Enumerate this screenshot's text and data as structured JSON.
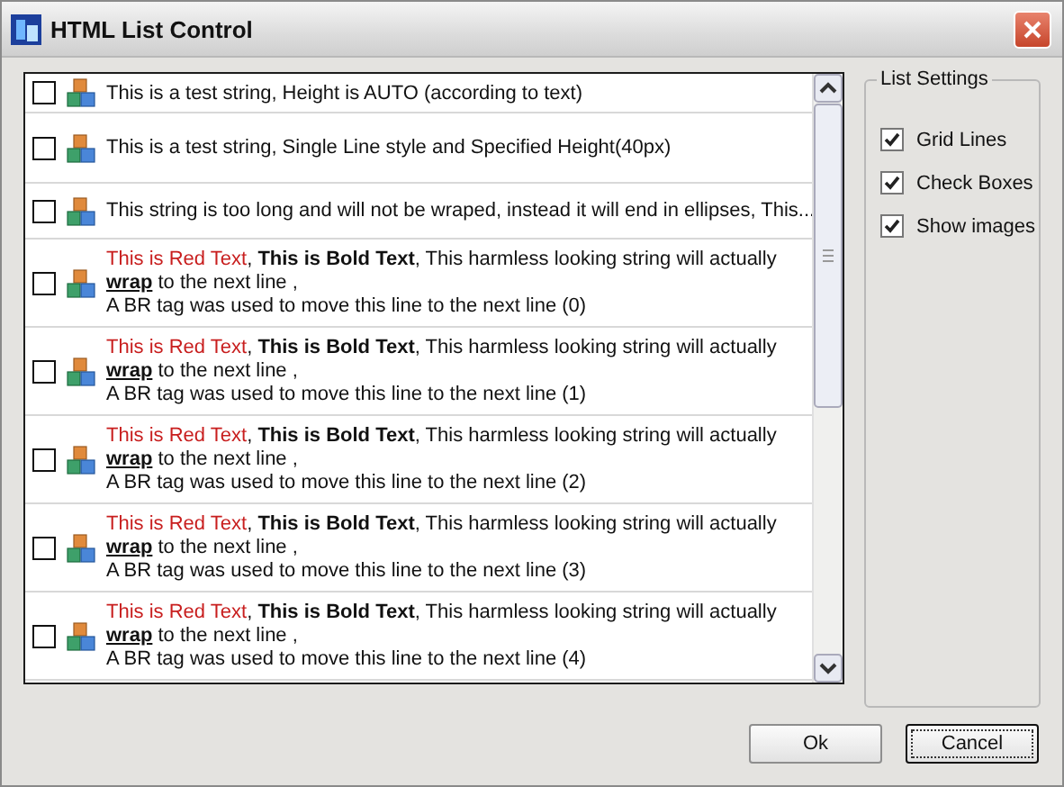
{
  "window": {
    "title": "HTML List Control"
  },
  "list": {
    "rows": [
      {
        "kind": "auto",
        "checked": false,
        "text": "This is a test string, Height is AUTO (according to text)"
      },
      {
        "kind": "fixed",
        "checked": false,
        "text": "This is a test string, Single Line style and Specified Height(40px)"
      },
      {
        "kind": "ellipsis",
        "checked": false,
        "text": "This string is too long and will not be wraped, instead it will end in ellipses, This..."
      },
      {
        "kind": "rich",
        "checked": false,
        "red": "This is Red Text",
        "sep": ",",
        "bold": "This is Bold Text",
        "middle": ", This harmless looking string will actually",
        "link": "wrap",
        "after": "to the next line ,",
        "second_line": "A BR tag was used to move this line to the next line (0)"
      },
      {
        "kind": "rich",
        "checked": false,
        "red": "This is Red Text",
        "sep": ",",
        "bold": "This is Bold Text",
        "middle": ", This harmless looking string will actually",
        "link": "wrap",
        "after": "to the next line ,",
        "second_line": "A BR tag was used to move this line to the next line (1)"
      },
      {
        "kind": "rich",
        "checked": false,
        "red": "This is Red Text",
        "sep": ",",
        "bold": "This is Bold Text",
        "middle": ", This harmless looking string will actually",
        "link": "wrap",
        "after": "to the next line ,",
        "second_line": "A BR tag was used to move this line to the next line (2)"
      },
      {
        "kind": "rich",
        "checked": false,
        "red": "This is Red Text",
        "sep": ",",
        "bold": "This is Bold Text",
        "middle": ", This harmless looking string will actually",
        "link": "wrap",
        "after": "to the next line ,",
        "second_line": "A BR tag was used to move this line to the next line (3)"
      },
      {
        "kind": "rich",
        "checked": false,
        "red": "This is Red Text",
        "sep": ",",
        "bold": "This is Bold Text",
        "middle": ", This harmless looking string will actually",
        "link": "wrap",
        "after": "to the next line ,",
        "second_line": "A BR tag was used to move this line to the next line (4)"
      }
    ]
  },
  "settings": {
    "title": "List Settings",
    "options": [
      {
        "label": "Grid Lines",
        "checked": true
      },
      {
        "label": "Check Boxes",
        "checked": true
      },
      {
        "label": "Show images",
        "checked": true
      }
    ]
  },
  "buttons": [
    {
      "label": "Ok",
      "focused": false
    },
    {
      "label": "Cancel",
      "focused": true
    }
  ]
}
